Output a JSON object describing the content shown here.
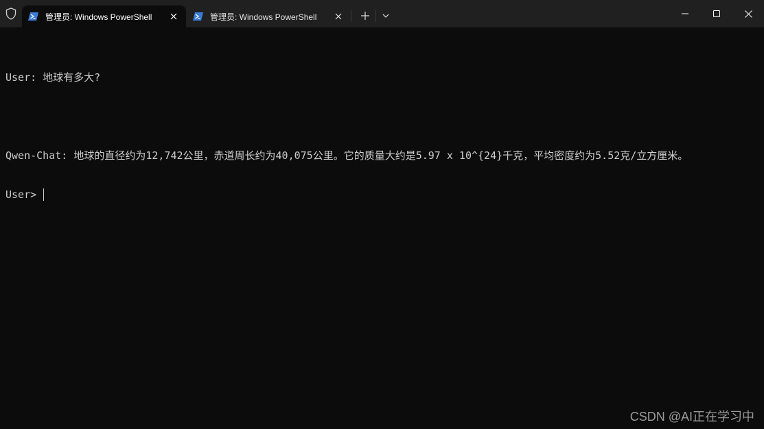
{
  "colors": {
    "titlebar": "#202020",
    "terminal_bg": "#0c0c0c",
    "terminal_fg": "#cccccc",
    "powershell_icon": "#3b7bd9"
  },
  "tabs": [
    {
      "title": "管理员: Windows PowerShell",
      "active": true,
      "icon": "powershell-icon"
    },
    {
      "title": "管理员: Windows PowerShell",
      "active": false,
      "icon": "powershell-icon"
    }
  ],
  "terminal": {
    "lines": [
      "User: 地球有多大?",
      "",
      "Qwen-Chat: 地球的直径约为12,742公里，赤道周长约为40,075公里。它的质量大约是5.97 x 10^{24}千克，平均密度约为5.52克/立方厘米。",
      "User> "
    ]
  },
  "watermark": "CSDN @AI正在学习中"
}
